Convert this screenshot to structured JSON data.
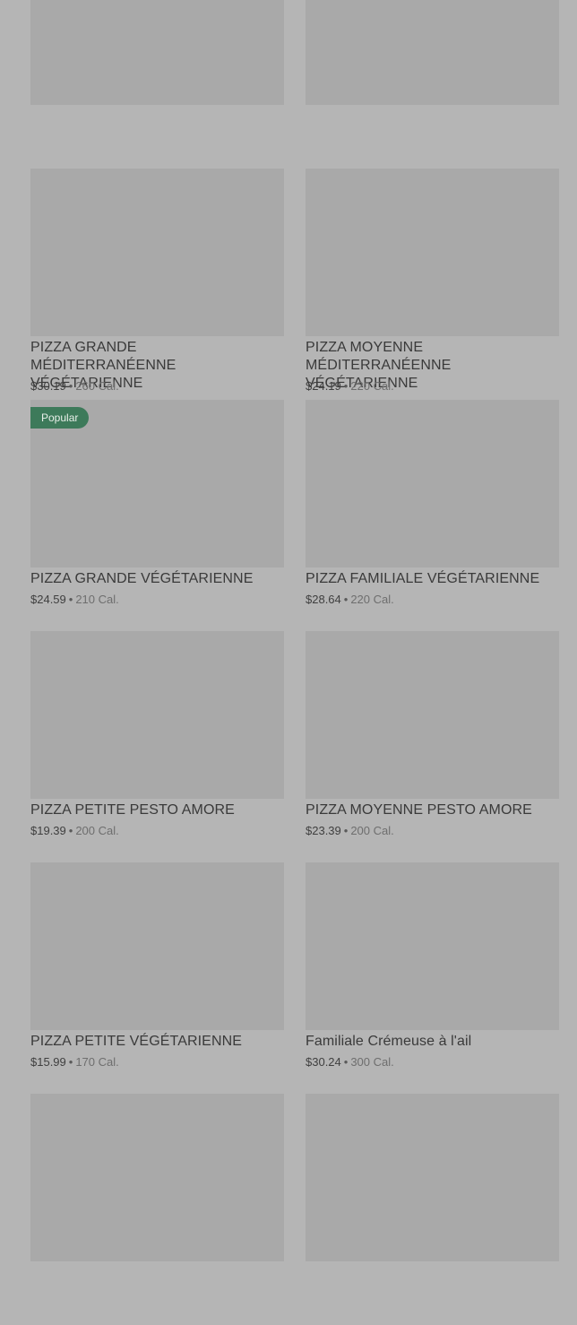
{
  "cards": [
    {
      "title": "",
      "price": "",
      "calories": "",
      "badge": ""
    },
    {
      "title": "",
      "price": "",
      "calories": "",
      "badge": ""
    },
    {
      "title": "PIZZA GRANDE MÉDITERRANÉENNE VÉGÉTARIENNE",
      "price": "$30.19",
      "calories": "260 Cal.",
      "badge": ""
    },
    {
      "title": "PIZZA MOYENNE MÉDITERRANÉENNE VÉGÉTARIENNE",
      "price": "$24.19",
      "calories": "220 Cal.",
      "badge": ""
    },
    {
      "title": "PIZZA GRANDE VÉGÉTARIENNE",
      "price": "$24.59",
      "calories": "210 Cal.",
      "badge": "Popular"
    },
    {
      "title": "PIZZA FAMILIALE VÉGÉTARIENNE",
      "price": "$28.64",
      "calories": "220 Cal.",
      "badge": ""
    },
    {
      "title": "PIZZA PETITE PESTO AMORE",
      "price": "$19.39",
      "calories": "200 Cal.",
      "badge": ""
    },
    {
      "title": "PIZZA MOYENNE PESTO AMORE",
      "price": "$23.39",
      "calories": "200 Cal.",
      "badge": ""
    },
    {
      "title": "PIZZA PETITE VÉGÉTARIENNE",
      "price": "$15.99",
      "calories": "170 Cal.",
      "badge": ""
    },
    {
      "title": "Familiale Crémeuse à l'ail",
      "price": "$30.24",
      "calories": "300 Cal.",
      "badge": ""
    },
    {
      "title": "",
      "price": "",
      "calories": "",
      "badge": ""
    },
    {
      "title": "",
      "price": "",
      "calories": "",
      "badge": ""
    }
  ],
  "separator": "•"
}
